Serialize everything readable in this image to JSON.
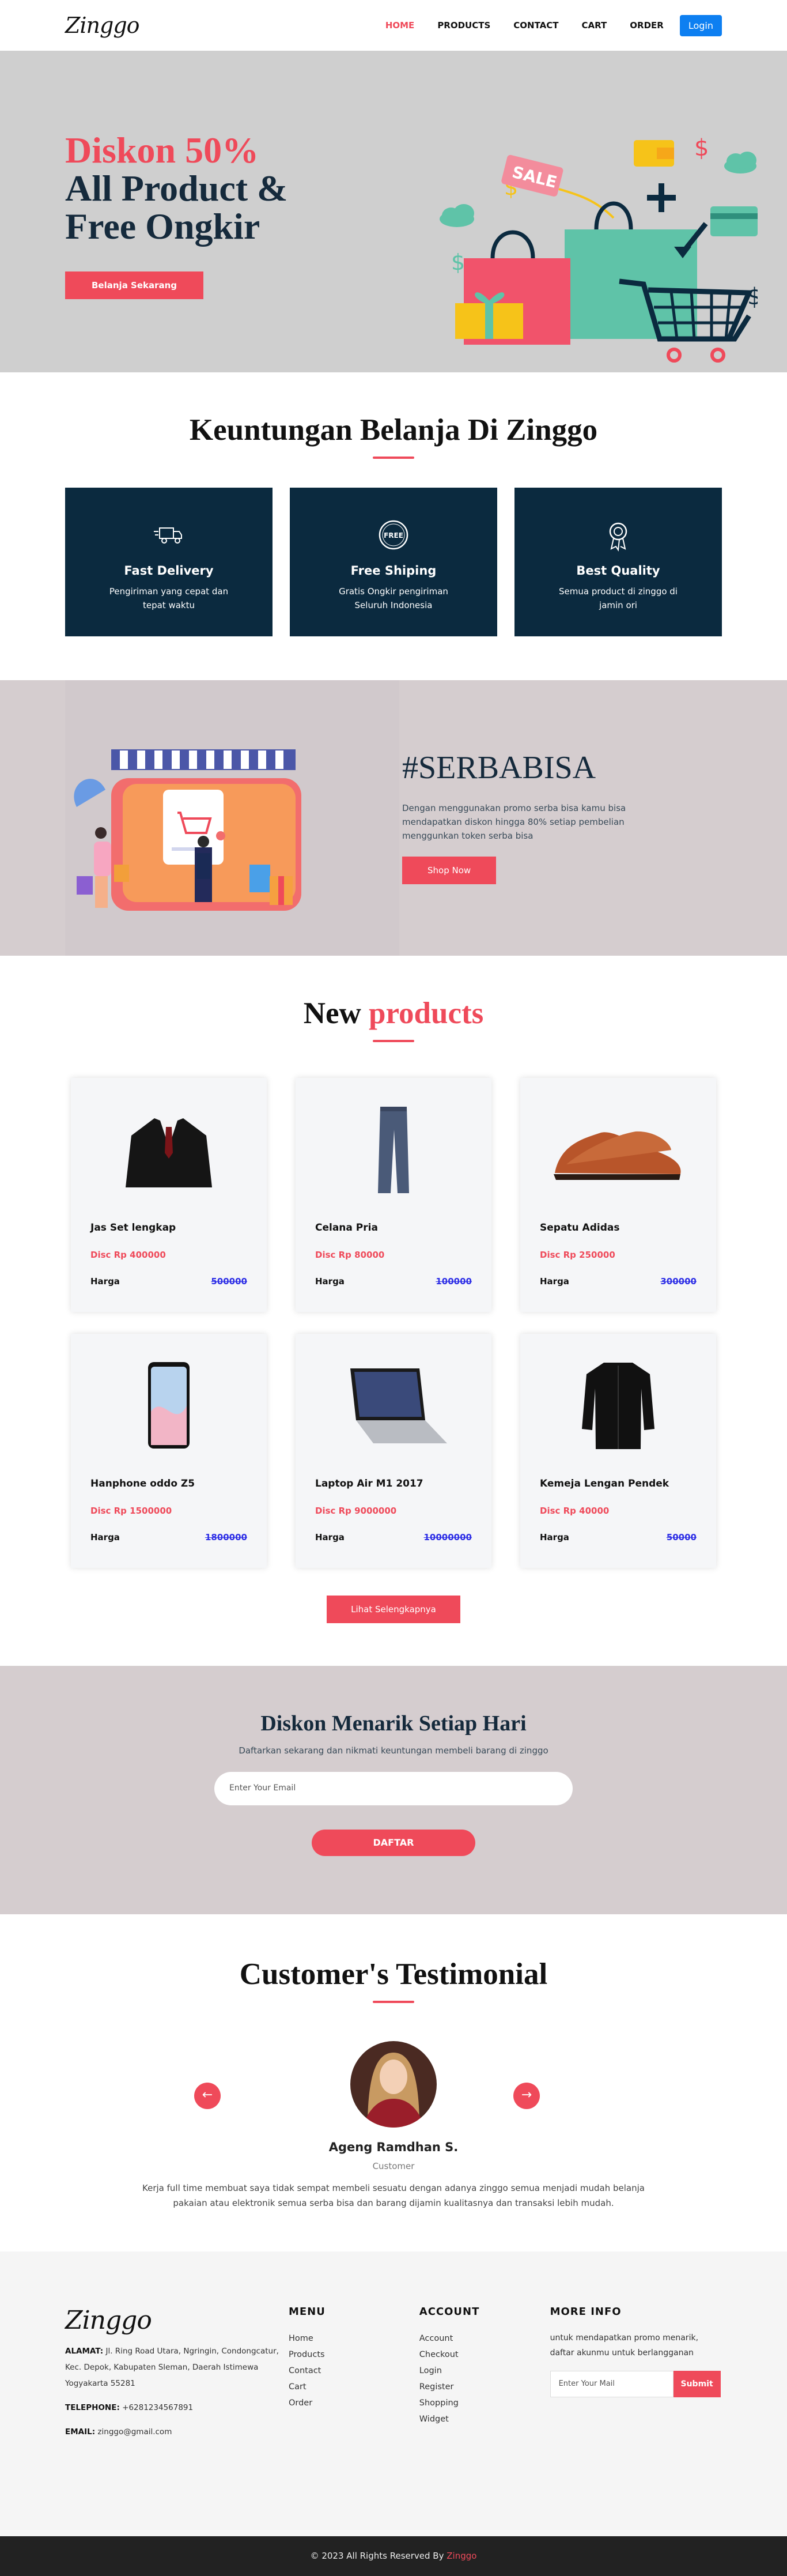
{
  "nav": {
    "logo": "Zinggo",
    "items": [
      "HOME",
      "PRODUCTS",
      "CONTACT",
      "CART",
      "ORDER"
    ],
    "login": "Login"
  },
  "hero": {
    "line1": "Diskon 50%",
    "line2": "All Product &",
    "line3": "Free Ongkir",
    "button": "Belanja Sekarang"
  },
  "advantages": {
    "title": "Keuntungan Belanja Di Zinggo",
    "cards": [
      {
        "icon": "delivery-truck-icon",
        "title": "Fast Delivery",
        "text": "Pengiriman yang cepat dan tepat waktu"
      },
      {
        "icon": "free-badge-icon",
        "title": "Free Shiping",
        "text": "Gratis Ongkir pengiriman Seluruh Indonesia"
      },
      {
        "icon": "quality-medal-icon",
        "title": "Best Quality",
        "text": "Semua product di zinggo di jamin ori"
      }
    ]
  },
  "serbabisa": {
    "title": "#SERBABISA",
    "text": "Dengan menggunakan promo serba bisa kamu bisa mendapatkan diskon hingga 80% setiap pembelian menggunkan token serba bisa",
    "button": "Shop Now"
  },
  "products": {
    "title_black": "New",
    "title_red": "products",
    "price_label": "Harga",
    "items": [
      {
        "name": "Jas Set lengkap",
        "disc": "Disc Rp 400000",
        "price": "500000",
        "img": "suit"
      },
      {
        "name": "Celana Pria",
        "disc": "Disc Rp 80000",
        "price": "100000",
        "img": "pants"
      },
      {
        "name": "Sepatu Adidas",
        "disc": "Disc Rp 250000",
        "price": "300000",
        "img": "shoe"
      },
      {
        "name": "Hanphone oddo Z5",
        "disc": "Disc Rp 1500000",
        "price": "1800000",
        "img": "phone"
      },
      {
        "name": "Laptop Air M1 2017",
        "disc": "Disc Rp 9000000",
        "price": "10000000",
        "img": "laptop"
      },
      {
        "name": "Kemeja Lengan Pendek",
        "disc": "Disc Rp 40000",
        "price": "50000",
        "img": "shirt"
      }
    ],
    "more": "Lihat Selengkapnya"
  },
  "diskon": {
    "title": "Diskon Menarik Setiap Hari",
    "text": "Daftarkan sekarang dan nikmati keuntungan membeli barang di zinggo",
    "placeholder": "Enter Your Email",
    "button": "DAFTAR"
  },
  "testimonial": {
    "title": "Customer's Testimonial",
    "prev": "←",
    "next": "→",
    "name": "Ageng Ramdhan S.",
    "role": "Customer",
    "quote": "Kerja full time membuat saya tidak sempat membeli sesuatu dengan adanya zinggo semua menjadi mudah belanja pakaian atau elektronik semua serba bisa dan barang dijamin kualitasnya dan transaksi lebih mudah."
  },
  "footer": {
    "logo": "Zinggo",
    "address_label": "ALAMAT:",
    "address": " Jl. Ring Road Utara, Ngringin, Condongcatur, Kec. Depok, Kabupaten Sleman, Daerah Istimewa Yogyakarta 55281",
    "phone_label": "TELEPHONE:",
    "phone": " +6281234567891",
    "email_label": "EMAIL:",
    "email": " zinggo@gmail.com",
    "menu_title": "MENU",
    "menu": [
      "Home",
      "Products",
      "Contact",
      "Cart",
      "Order"
    ],
    "account_title": "ACCOUNT",
    "account": [
      "Account",
      "Checkout",
      "Login",
      "Register",
      "Shopping",
      "Widget"
    ],
    "info_title": "MORE INFO",
    "info_text": "untuk mendapatkan promo menarik, daftar akunmu untuk berlangganan",
    "placeholder": "Enter Your Mail",
    "submit": "Submit"
  },
  "copyright": {
    "text": "© 2023 All Rights Reserved By ",
    "brand": "Zinggo"
  },
  "colors": {
    "accent": "#ef4a5a",
    "navy": "#0b2a3f",
    "blue": "#0d7ff1"
  }
}
